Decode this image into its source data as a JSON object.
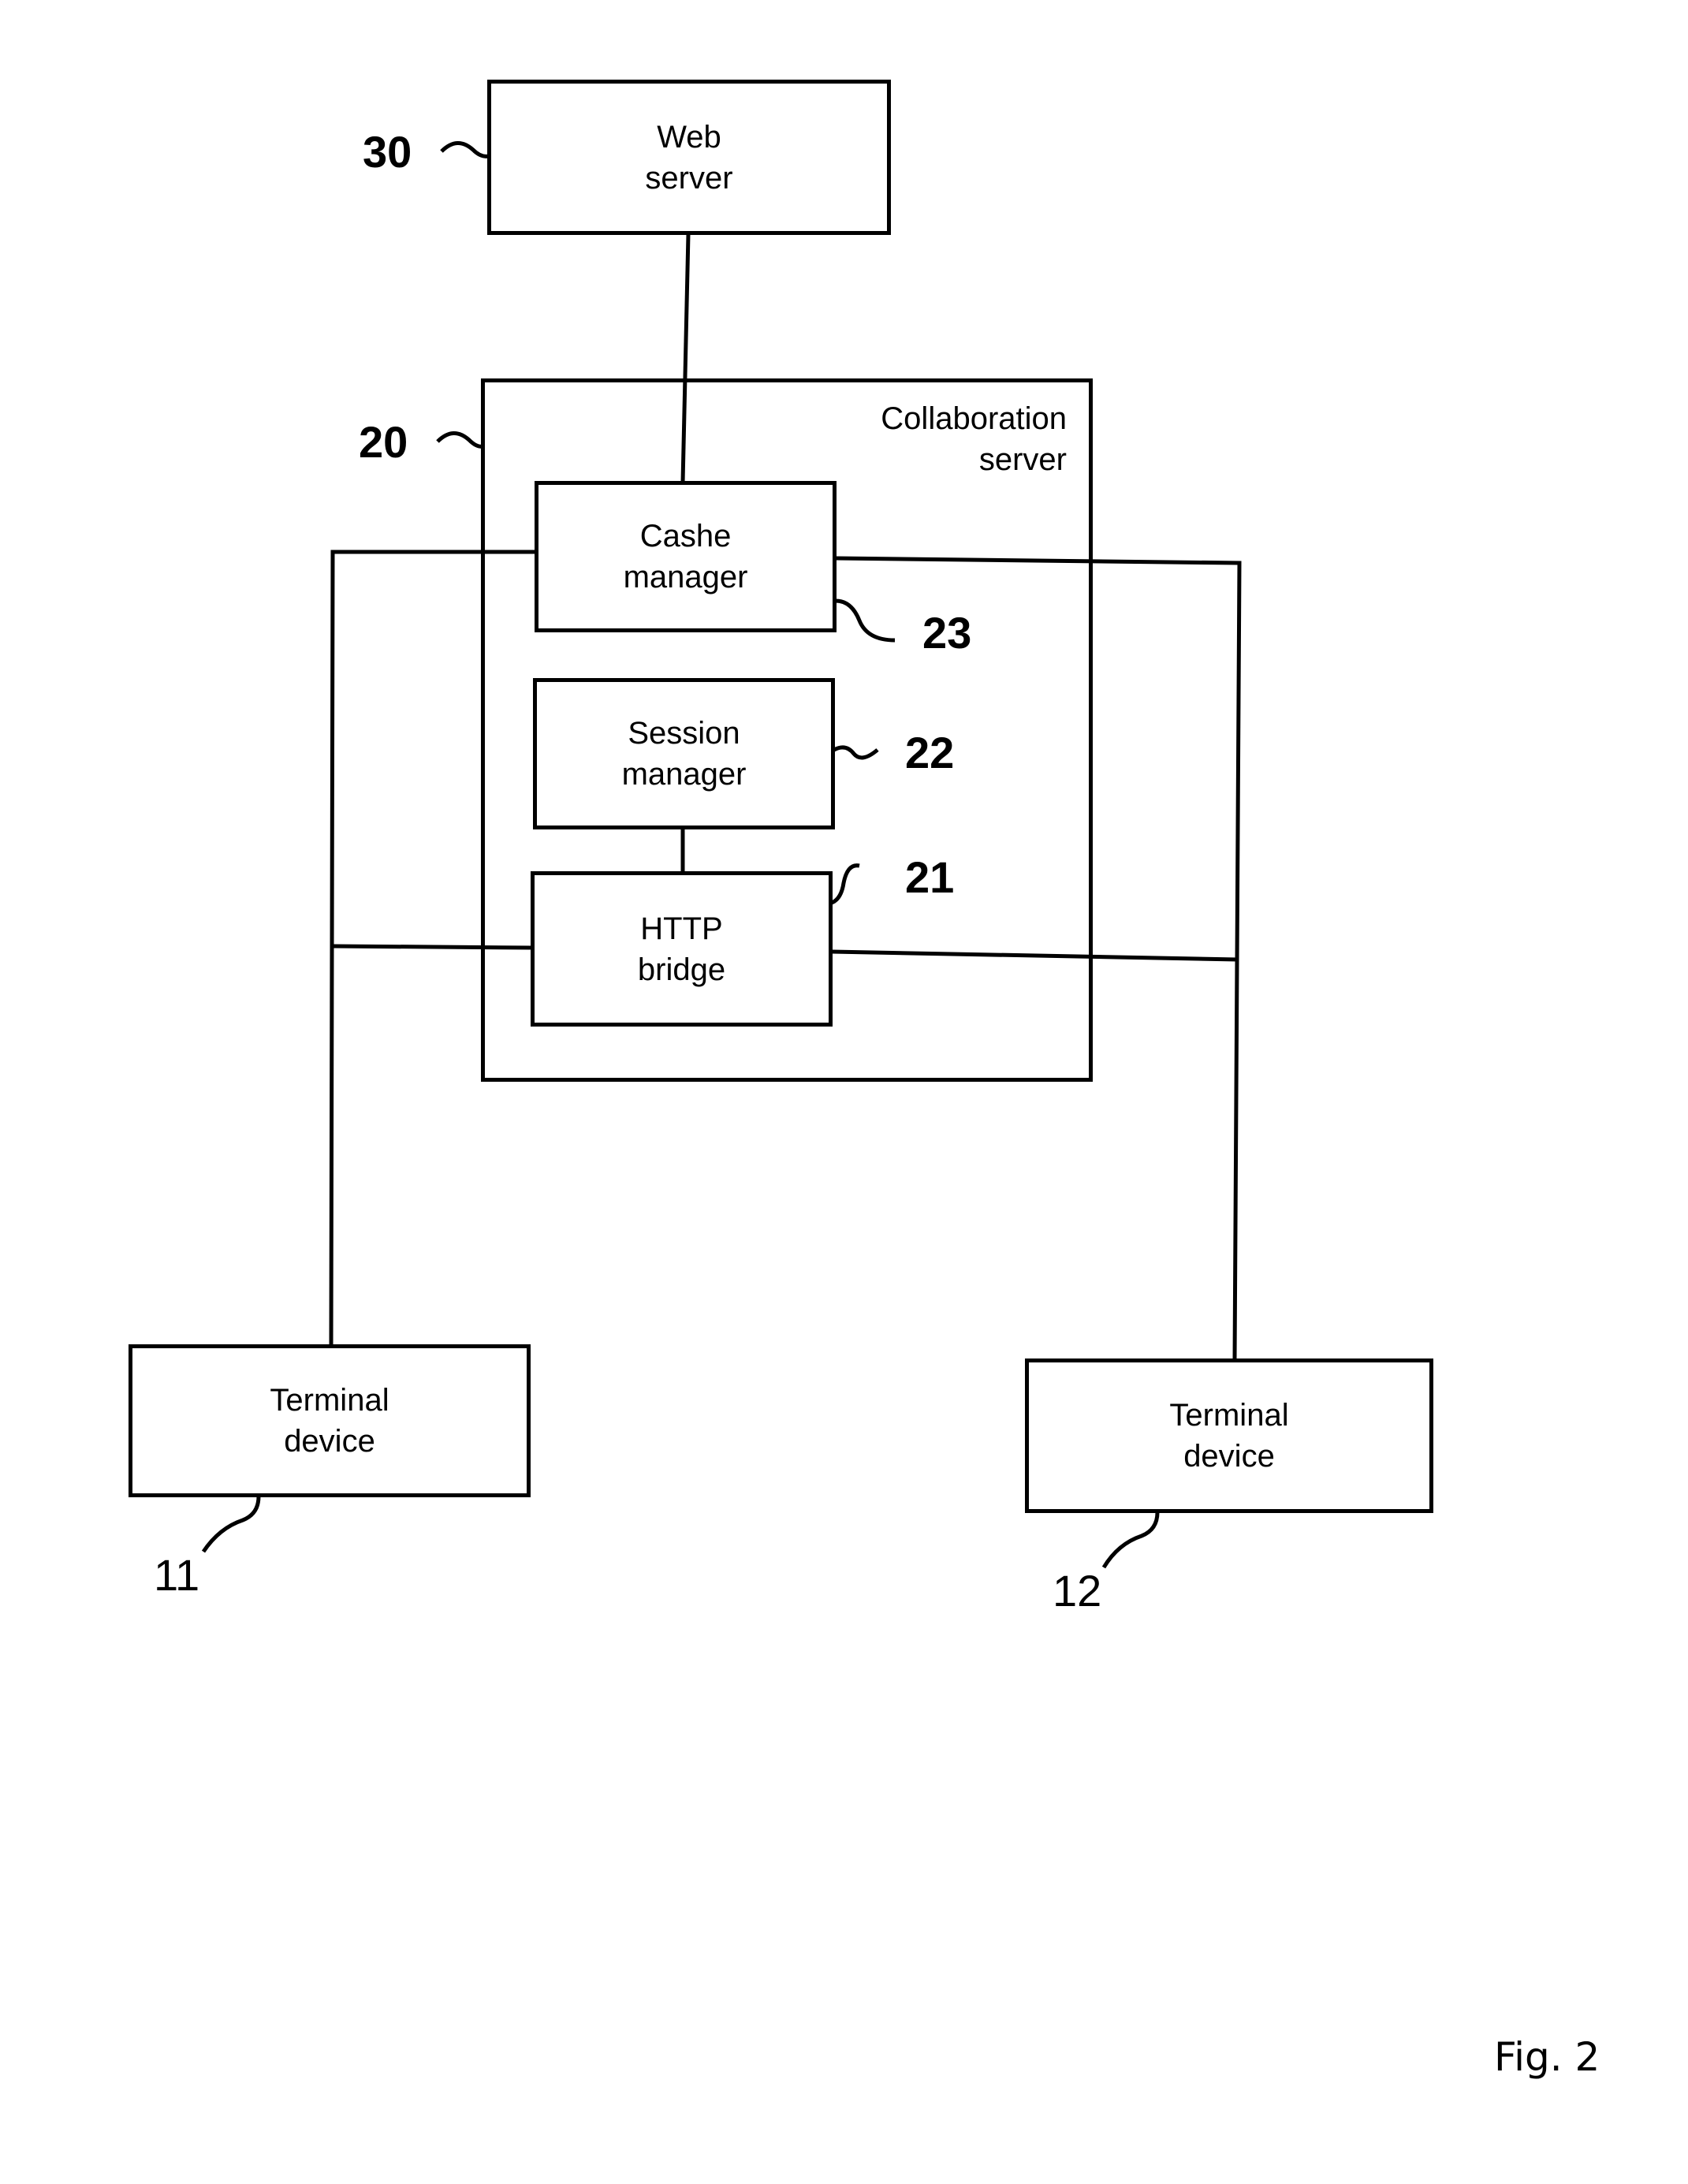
{
  "figure_label": "Fig. 2",
  "nodes": {
    "web_server": {
      "ref": "30",
      "line1": "Web",
      "line2": "server"
    },
    "collaboration_server": {
      "ref": "20",
      "line1": "Collaboration",
      "line2": "server"
    },
    "cashe_manager": {
      "ref": "23",
      "line1": "Cashe",
      "line2": "manager"
    },
    "session_manager": {
      "ref": "22",
      "line1": "Session",
      "line2": "manager"
    },
    "http_bridge": {
      "ref": "21",
      "line1": "HTTP",
      "line2": "bridge"
    },
    "terminal_11": {
      "ref": "11",
      "line1": "Terminal",
      "line2": "device"
    },
    "terminal_12": {
      "ref": "12",
      "line1": "Terminal",
      "line2": "device"
    }
  },
  "connections": [
    [
      "web_server",
      "cashe_manager"
    ],
    [
      "session_manager",
      "http_bridge"
    ],
    [
      "cashe_manager",
      "terminal_11"
    ],
    [
      "cashe_manager",
      "terminal_12"
    ],
    [
      "http_bridge",
      "terminal_11"
    ],
    [
      "http_bridge",
      "terminal_12"
    ]
  ]
}
